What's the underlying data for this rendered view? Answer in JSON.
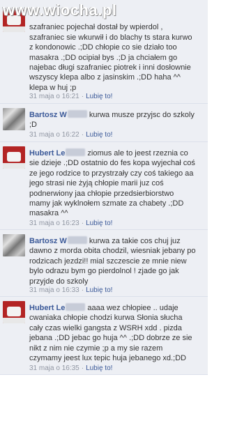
{
  "watermark": "www.wiocha.pl",
  "comments": [
    {
      "author": "",
      "text": "szafraniec pojechał dostał by wpierdol , szafraniec sie wkurwił i do blachy ts stara kurwo z kondonowic .;DD chłopie co sie działo too masakra .;DD ocipiał bys .;D ja chciałem go najebac długi szafraniec piotrek i inni dosłownie wszyscy klepa albo z jasinskim .;DD haha ^^ klepa w huj ;p",
      "timestamp": "31 maja o 16:21",
      "like": "Lubię to!"
    },
    {
      "author": "Bartosz W",
      "text": " kurwa musze przyjsc do szkoly ;D",
      "timestamp": "31 maja o 16:22",
      "like": "Lubię to!"
    },
    {
      "author": "Hubert Le",
      "text": " ziomus ale to jeest rzeznia co sie dzieje .;DD ostatnio do fes kopa wyjechał coś ze jego rodzice to przystrzały czy coś takiego aa jego strasi nie żyją chłopie marii juz coś podnerwiony jaa chłopie przedsierbiorstwo mamy jak wyklnołem szmate za chabety .;DD masakra ^^",
      "timestamp": "31 maja o 16:23",
      "like": "Lubię to!"
    },
    {
      "author": "Bartosz W",
      "text": " kurwa za takie cos chuj juz dawno z morda obita chodzil, wiesniak jebany po rodzicach jezdzi!! mial szczescie ze mnie niew bylo odrazu bym go pierdolnol ! zjade go jak przyjde do szkoly",
      "timestamp": "31 maja o 16:33",
      "like": "Lubię to!"
    },
    {
      "author": "Hubert Le",
      "text": " aaaa wez chłopiee .. udaje cwaniaka chłopie chodzi kurwa Słonia słucha cały czas wielki gangsta z WSRH xdd . pizda jebana .;DD jebac go huja ^^ .;DD dobrze ze sie nikt z nim nie czymie ;p a my sie razem czymamy jeest lux tepic huja jebanego xd.;DD",
      "timestamp": "31 maja o 16:35",
      "like": "Lubię to!"
    }
  ],
  "colors": {
    "background": "#edeff4",
    "author": "#3b5998",
    "meta": "#9197a3",
    "link": "#3b5998"
  }
}
